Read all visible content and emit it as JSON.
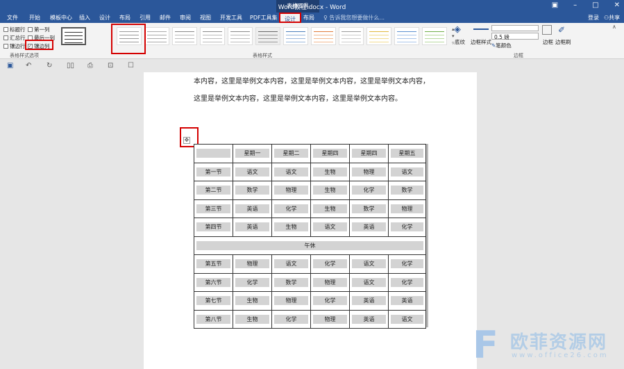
{
  "window": {
    "title": "Word教程.docx - Word",
    "context_tab_group": "表格工具"
  },
  "tabs": [
    "文件",
    "开始",
    "模板中心",
    "插入",
    "设计",
    "布局",
    "引用",
    "邮件",
    "审阅",
    "视图",
    "开发工具",
    "PDF工具集",
    "设计",
    "布局"
  ],
  "search_placeholder": "告诉我您想要做什么...",
  "account": {
    "login": "登录",
    "share": "共享"
  },
  "ribbon": {
    "style_options": {
      "items": [
        "标题行",
        "第一列",
        "汇总行",
        "最后一列",
        "镶边行",
        "镶边列"
      ],
      "group_label": "表格样式选项"
    },
    "table_styles": {
      "group_label": "表格样式"
    },
    "shading_label": "底纹",
    "border_styles_label": "边框样式",
    "pen_weight": "0.5 磅",
    "pen_color_label": "笔颜色",
    "borders_label": "边框",
    "border_painter_label": "边框刷",
    "borders_group_label": "边框"
  },
  "document": {
    "paragraphs": [
      "本内容，这里是举例文本内容，这里是举例文本内容，这里是举例文本内容，",
      "这里是举例文本内容，这里是举例文本内容，这里是举例文本内容。"
    ],
    "table": {
      "header": [
        "",
        "星期一",
        "星期二",
        "星期四",
        "星期四",
        "星期五"
      ],
      "rows_before_break": [
        [
          "第一节",
          "语文",
          "语文",
          "生物",
          "物理",
          "语文"
        ],
        [
          "第二节",
          "数学",
          "物理",
          "生物",
          "化学",
          "数学"
        ],
        [
          "第三节",
          "英语",
          "化学",
          "生物",
          "数学",
          "物理"
        ],
        [
          "第四节",
          "英语",
          "生物",
          "语文",
          "英语",
          "化学"
        ]
      ],
      "break_label": "午休",
      "rows_after_break": [
        [
          "第五节",
          "物理",
          "语文",
          "化学",
          "语文",
          "化学"
        ],
        [
          "第六节",
          "化学",
          "数学",
          "物理",
          "语文",
          "化学"
        ],
        [
          "第七节",
          "生物",
          "物理",
          "化学",
          "英语",
          "英语"
        ],
        [
          "第八节",
          "生物",
          "化学",
          "物理",
          "英语",
          "语文"
        ]
      ]
    }
  },
  "watermark": {
    "brand": "欧菲资源网",
    "url": "www.office26.com"
  },
  "colors": {
    "title_bar": "#2b579a",
    "highlight_box": "#d40000",
    "cell_shading": "#d3d3d3"
  }
}
